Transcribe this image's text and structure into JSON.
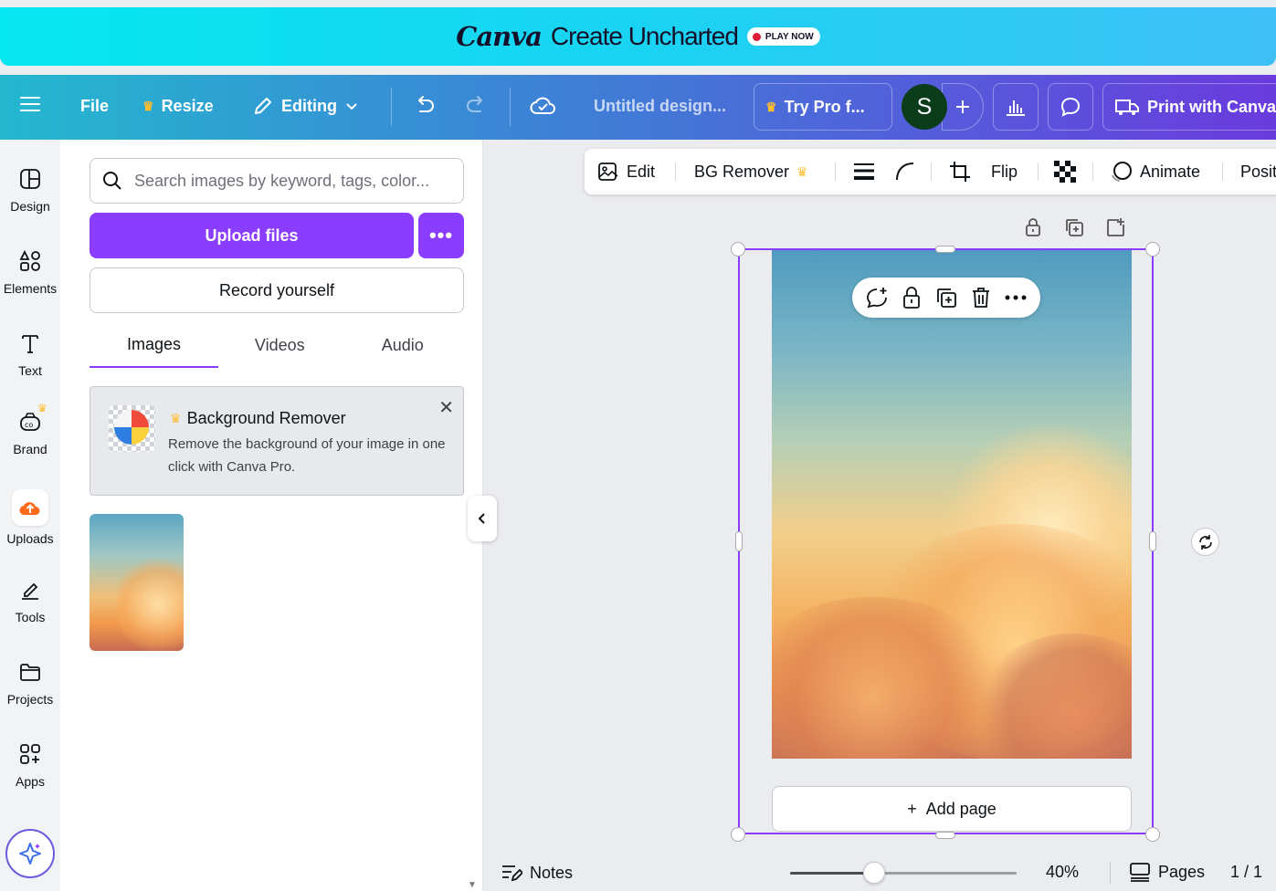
{
  "banner": {
    "logo": "Canva",
    "tagline": "Create Uncharted",
    "play_label": "PLAY NOW",
    "dot_color": "#e01b3a"
  },
  "topbar": {
    "file": "File",
    "resize": "Resize",
    "editing": "Editing",
    "title": "Untitled design...",
    "try_pro": "Try Pro f...",
    "avatar_initial": "S",
    "print": "Print with Canva",
    "gradient": [
      "#24b8cf",
      "#3e7fd6",
      "#6a3bde"
    ]
  },
  "rail": {
    "items": [
      {
        "label": "Design",
        "icon": "layout-icon"
      },
      {
        "label": "Elements",
        "icon": "shapes-icon"
      },
      {
        "label": "Text",
        "icon": "text-t-icon"
      },
      {
        "label": "Brand",
        "icon": "brand-icon"
      },
      {
        "label": "Uploads",
        "icon": "cloud-upload-icon"
      },
      {
        "label": "Tools",
        "icon": "pen-tool-icon"
      },
      {
        "label": "Projects",
        "icon": "folder-icon"
      },
      {
        "label": "Apps",
        "icon": "apps-grid-icon"
      }
    ],
    "active": "Uploads"
  },
  "panel": {
    "search_placeholder": "Search images by keyword, tags, color...",
    "upload_label": "Upload files",
    "more_label": "•••",
    "record_label": "Record yourself",
    "tabs": [
      "Images",
      "Videos",
      "Audio"
    ],
    "active_tab": "Images",
    "promo": {
      "title": "Background Remover",
      "text": "Remove the background of your image in one click with Canva Pro.",
      "close": "✕"
    },
    "accent": "#8b3dff"
  },
  "context_toolbar": {
    "edit": "Edit",
    "bg_remover": "BG Remover",
    "flip": "Flip",
    "animate": "Animate",
    "position": "Posit"
  },
  "canvas": {
    "add_page": "Add page",
    "add_page_plus": "+"
  },
  "bottom": {
    "notes": "Notes",
    "zoom": "40%",
    "zoom_fraction": 0.37,
    "pages": "Pages",
    "page_count": "1 / 1"
  }
}
